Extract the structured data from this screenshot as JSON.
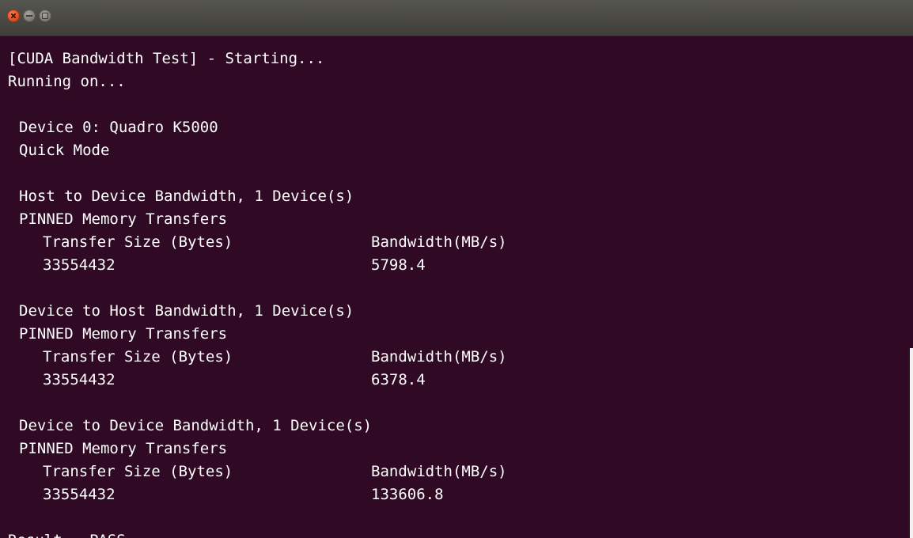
{
  "window": {
    "buttons": {
      "close": "close-icon",
      "minimize": "minimize-icon",
      "maximize": "maximize-icon"
    }
  },
  "terminal": {
    "header": {
      "starting": "[CUDA Bandwidth Test] - Starting...",
      "running": "Running on..."
    },
    "device": {
      "name": "Device 0: Quadro K5000",
      "mode": "Quick Mode"
    },
    "sections": [
      {
        "title": "Host to Device Bandwidth, 1 Device(s)",
        "memory": "PINNED Memory Transfers",
        "col1_header": "Transfer Size (Bytes)",
        "col2_header": "Bandwidth(MB/s)",
        "size": "33554432",
        "bandwidth": "5798.4"
      },
      {
        "title": "Device to Host Bandwidth, 1 Device(s)",
        "memory": "PINNED Memory Transfers",
        "col1_header": "Transfer Size (Bytes)",
        "col2_header": "Bandwidth(MB/s)",
        "size": "33554432",
        "bandwidth": "6378.4"
      },
      {
        "title": "Device to Device Bandwidth, 1 Device(s)",
        "memory": "PINNED Memory Transfers",
        "col1_header": "Transfer Size (Bytes)",
        "col2_header": "Bandwidth(MB/s)",
        "size": "33554432",
        "bandwidth": "133606.8"
      }
    ],
    "result": "Result = PASS"
  },
  "colors": {
    "terminal_bg": "#300a24",
    "text": "#ffffff",
    "titlebar": "#4a4945",
    "close_button": "#e4561c"
  }
}
